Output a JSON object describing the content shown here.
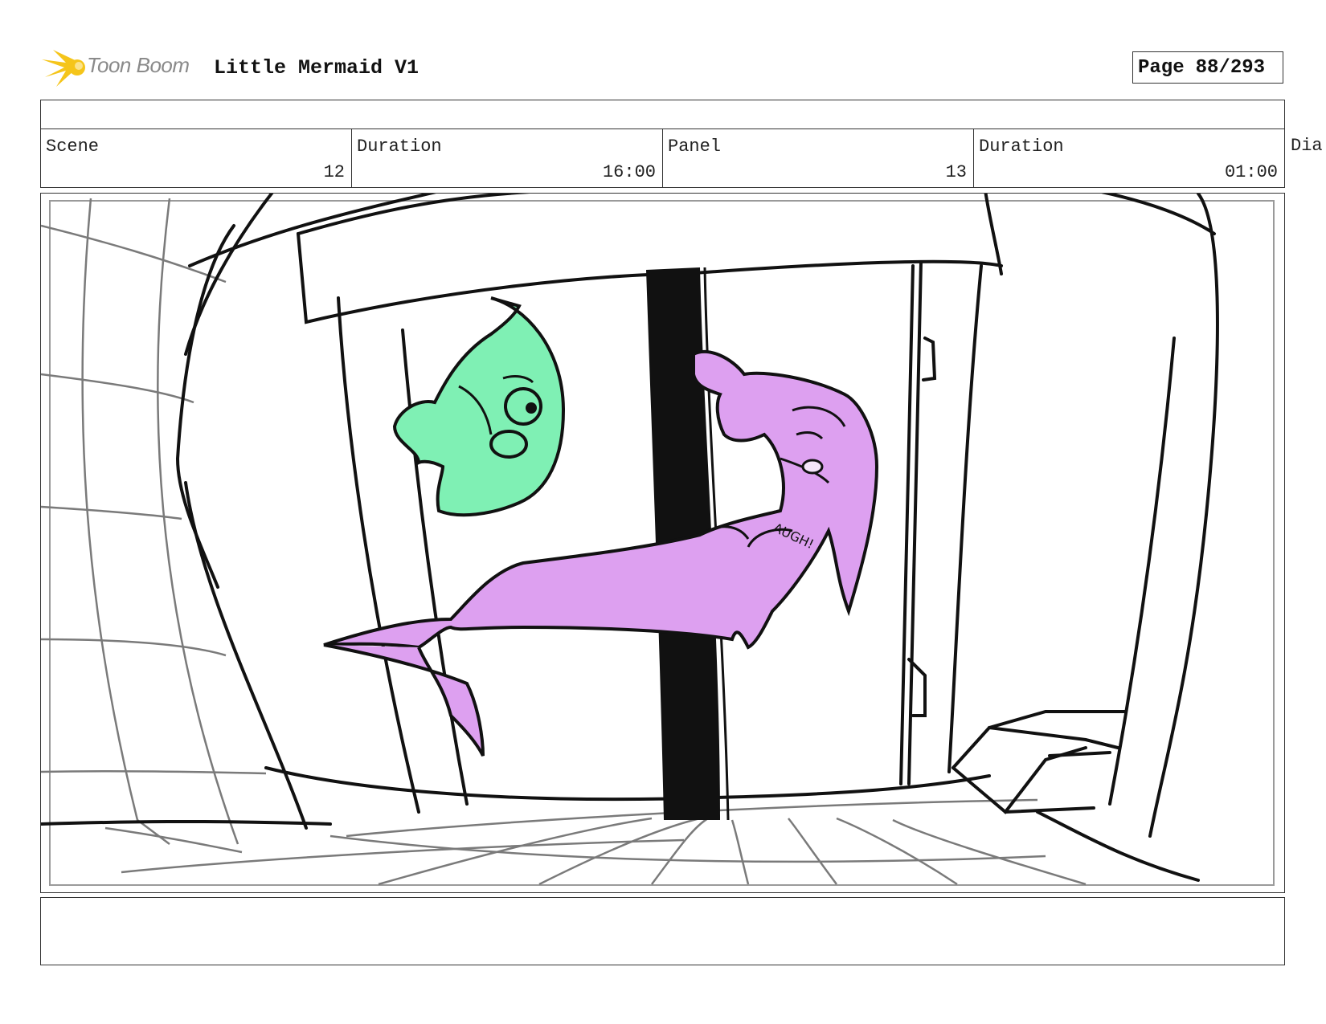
{
  "header": {
    "logo_text": "Toon Boom",
    "project_title": "Little Mermaid V1",
    "page_label": "Page",
    "page_value": "88/293"
  },
  "info": {
    "scene_label": "Scene",
    "scene_value": "12",
    "scene_duration_label": "Duration",
    "scene_duration_value": "16:00",
    "panel_label": "Panel",
    "panel_value": "13",
    "panel_duration_label": "Duration",
    "panel_duration_value": "01:00",
    "dialogue_label": "Dia"
  },
  "sketch": {
    "fish_text": "",
    "mermaid_shirt_text": "AUGH!"
  },
  "colors": {
    "fish_fill": "#7ff0b4",
    "mermaid_fill": "#dda0f0",
    "line": "#111111",
    "logo_yellow": "#f5c51a",
    "logo_text": "#8a8a8a"
  }
}
